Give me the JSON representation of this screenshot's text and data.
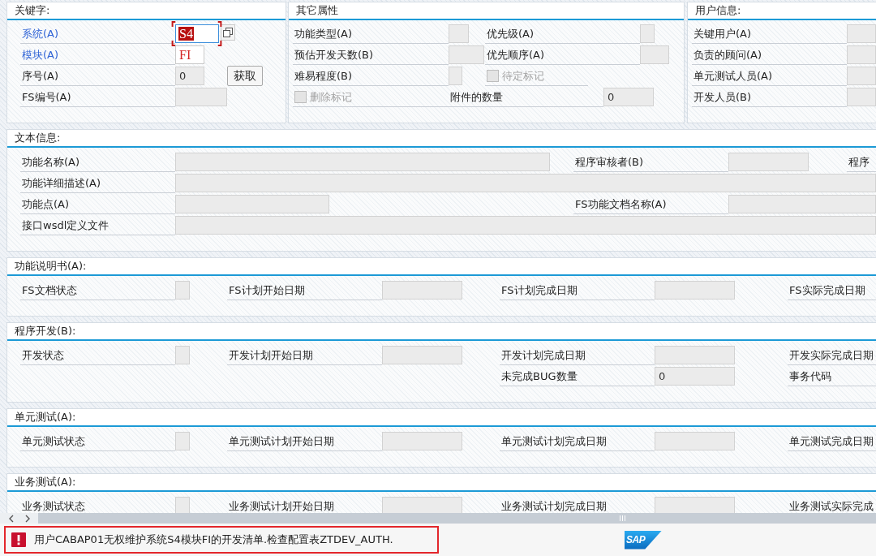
{
  "groups": [
    {
      "title": "关键字:",
      "rows": [
        [
          {
            "kind": "field",
            "label": "系统(A)",
            "highlighted": true,
            "value": "S4",
            "disabled": false,
            "error": true,
            "focused": true,
            "value_help": true
          }
        ],
        [
          {
            "kind": "field",
            "label": "模块(A)",
            "highlighted": true,
            "value": "FI",
            "disabled": false,
            "error": true,
            "focused": false,
            "value_help": false
          }
        ],
        [
          {
            "kind": "field",
            "label": "序号(A)",
            "highlighted": false,
            "value": "0",
            "disabled": true,
            "error": false,
            "focused": false,
            "value_help": false
          },
          {
            "kind": "button",
            "label": "获取"
          }
        ],
        [
          {
            "kind": "field",
            "label": "FS编号(A)",
            "highlighted": false,
            "disabled": true,
            "focused": false,
            "value_help": false
          }
        ]
      ]
    },
    {
      "title": "其它属性",
      "rows": [
        [
          {
            "kind": "field",
            "label": "功能类型(A)",
            "disabled": true
          },
          {
            "kind": "field",
            "label": "优先级(A)",
            "disabled": true
          }
        ],
        [
          {
            "kind": "field",
            "label": "预估开发天数(B)",
            "disabled": true
          },
          {
            "kind": "field",
            "label": "优先顺序(A)",
            "disabled": true
          }
        ],
        [
          {
            "kind": "field",
            "label": "难易程度(B)",
            "disabled": true
          },
          {
            "kind": "checkbox",
            "label": "待定标记",
            "checked": false,
            "disabled": true
          }
        ],
        [
          {
            "kind": "checkbox",
            "label": "删除标记",
            "checked": false,
            "disabled": true
          },
          {
            "kind": "field",
            "label": "附件的数量",
            "value": "0",
            "disabled": true
          }
        ]
      ]
    },
    {
      "title": "用户信息:",
      "rows": [
        [
          {
            "kind": "field",
            "label": "关键用户(A)",
            "disabled": true
          }
        ],
        [
          {
            "kind": "field",
            "label": "负责的顾问(A)",
            "disabled": true
          }
        ],
        [
          {
            "kind": "field",
            "label": "单元测试人员(A)",
            "disabled": true
          }
        ],
        [
          {
            "kind": "field",
            "label": "开发人员(B)",
            "disabled": true
          }
        ]
      ]
    }
  ],
  "sections": [
    {
      "title": "文本信息:",
      "rows": [
        [
          {
            "kind": "field",
            "label": "功能名称(A)",
            "disabled": true
          },
          {
            "kind": "field",
            "label": "程序审核者(B)",
            "disabled": true
          },
          {
            "kind": "label",
            "label": "程序"
          }
        ],
        [
          {
            "kind": "field",
            "label": "功能详细描述(A)",
            "disabled": true
          }
        ],
        [
          {
            "kind": "field",
            "label": "功能点(A)",
            "disabled": true
          },
          {
            "kind": "field",
            "label": "FS功能文档名称(A)",
            "disabled": true
          }
        ],
        [
          {
            "kind": "field",
            "label": "接口wsdl定义文件",
            "disabled": true
          }
        ]
      ]
    },
    {
      "title": "功能说明书(A):",
      "rows": [
        [
          {
            "kind": "field",
            "label": "FS文档状态",
            "disabled": true
          },
          {
            "kind": "field",
            "label": "FS计划开始日期",
            "disabled": true
          },
          {
            "kind": "field",
            "label": "FS计划完成日期",
            "disabled": true
          },
          {
            "kind": "label",
            "label": "FS实际完成日期"
          }
        ]
      ]
    },
    {
      "title": "程序开发(B):",
      "rows": [
        [
          {
            "kind": "field",
            "label": "开发状态",
            "disabled": true
          },
          {
            "kind": "field",
            "label": "开发计划开始日期",
            "disabled": true
          },
          {
            "kind": "field",
            "label": "开发计划完成日期",
            "disabled": true
          },
          {
            "kind": "label",
            "label": "开发实际完成日期"
          }
        ],
        [
          "",
          "",
          {
            "kind": "field",
            "label": "未完成BUG数量",
            "value": "0",
            "disabled": true
          },
          {
            "kind": "label",
            "label": "事务代码"
          }
        ]
      ]
    },
    {
      "title": "单元测试(A):",
      "rows": [
        [
          {
            "kind": "field",
            "label": "单元测试状态",
            "disabled": true
          },
          {
            "kind": "field",
            "label": "单元测试计划开始日期",
            "disabled": true
          },
          {
            "kind": "field",
            "label": "单元测试计划完成日期",
            "disabled": true
          },
          {
            "kind": "label",
            "label": "单元测试完成日期"
          }
        ]
      ]
    },
    {
      "title": "业务测试(A):",
      "rows": [
        [
          {
            "kind": "field",
            "label": "业务测试状态",
            "disabled": true
          },
          {
            "kind": "field",
            "label": "业务测试计划开始日期",
            "disabled": true
          },
          {
            "kind": "field",
            "label": "业务测试计划完成日期",
            "disabled": true
          },
          {
            "kind": "label",
            "label": "业务测试实际完成"
          }
        ]
      ]
    }
  ],
  "status_bar": {
    "kind": "error",
    "message": "用户CABAP01无权维护系统S4模块FI的开发清单.检查配置表ZTDEV_AUTH."
  },
  "logo": "SAP"
}
